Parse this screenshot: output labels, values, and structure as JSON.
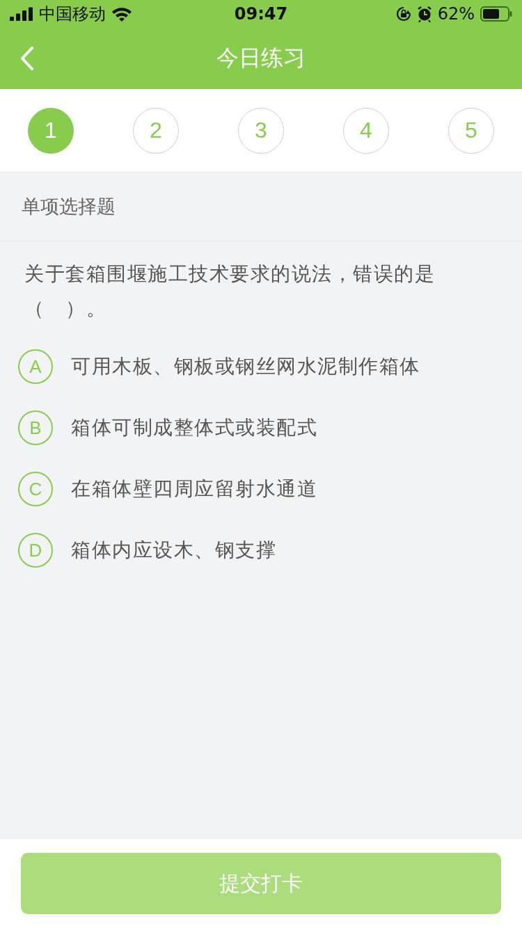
{
  "status_bar": {
    "carrier": "中国移动",
    "time": "09:47",
    "battery": "62%"
  },
  "nav": {
    "title": "今日练习"
  },
  "steps": [
    {
      "label": "1",
      "selected": true
    },
    {
      "label": "2",
      "selected": false
    },
    {
      "label": "3",
      "selected": false
    },
    {
      "label": "4",
      "selected": false
    },
    {
      "label": "5",
      "selected": false
    }
  ],
  "section": "单项选择题",
  "question": "关于套箱围堰施工技术要求的说法，错误的是（　）。",
  "options": [
    {
      "letter": "A",
      "text": "可用木板、钢板或钢丝网水泥制作箱体",
      "selected": false
    },
    {
      "letter": "B",
      "text": "箱体可制成整体式或装配式",
      "selected": false
    },
    {
      "letter": "C",
      "text": "在箱体壁四周应留射水通道",
      "selected": false
    },
    {
      "letter": "D",
      "text": "箱体内应设木、钢支撑",
      "selected": false
    }
  ],
  "submit": {
    "label": "提交打卡",
    "disabled": true
  }
}
